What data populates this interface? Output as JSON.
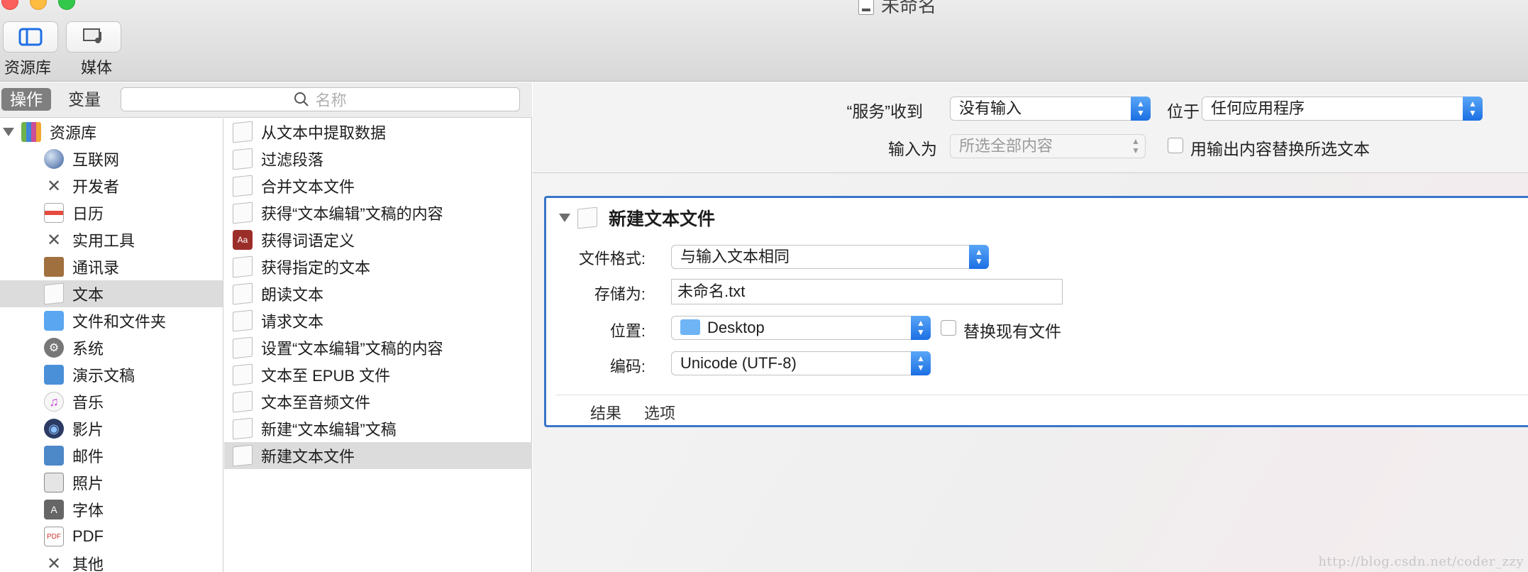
{
  "window": {
    "title": "未命名"
  },
  "toolbar": {
    "library_label": "资源库",
    "media_label": "媒体"
  },
  "left_pane": {
    "segment_actions": "操作",
    "segment_variables": "变量",
    "search_placeholder": "名称",
    "tree": {
      "root": "资源库",
      "items": [
        {
          "label": "互联网",
          "icon": "globe-icon"
        },
        {
          "label": "开发者",
          "icon": "tools-icon"
        },
        {
          "label": "日历",
          "icon": "calendar-icon"
        },
        {
          "label": "实用工具",
          "icon": "tools-icon"
        },
        {
          "label": "通讯录",
          "icon": "contacts-icon"
        },
        {
          "label": "文本",
          "icon": "text-icon",
          "selected": true
        },
        {
          "label": "文件和文件夹",
          "icon": "finder-icon"
        },
        {
          "label": "系统",
          "icon": "system-icon"
        },
        {
          "label": "演示文稿",
          "icon": "presentation-icon"
        },
        {
          "label": "音乐",
          "icon": "music-icon"
        },
        {
          "label": "影片",
          "icon": "movie-icon"
        },
        {
          "label": "邮件",
          "icon": "mail-icon"
        },
        {
          "label": "照片",
          "icon": "photo-icon"
        },
        {
          "label": "字体",
          "icon": "font-icon"
        },
        {
          "label": "PDF",
          "icon": "pdf-icon"
        },
        {
          "label": "其他",
          "icon": "tools-icon"
        }
      ]
    },
    "actions": [
      {
        "label": "从文本中提取数据",
        "icon": "text-icon"
      },
      {
        "label": "过滤段落",
        "icon": "text-icon"
      },
      {
        "label": "合并文本文件",
        "icon": "text-icon"
      },
      {
        "label": "获得“文本编辑”文稿的内容",
        "icon": "text-icon"
      },
      {
        "label": "获得词语定义",
        "icon": "dictionary-icon"
      },
      {
        "label": "获得指定的文本",
        "icon": "text-icon"
      },
      {
        "label": "朗读文本",
        "icon": "text-icon"
      },
      {
        "label": "请求文本",
        "icon": "text-icon"
      },
      {
        "label": "设置“文本编辑”文稿的内容",
        "icon": "text-icon"
      },
      {
        "label": "文本至 EPUB 文件",
        "icon": "text-icon"
      },
      {
        "label": "文本至音频文件",
        "icon": "text-icon"
      },
      {
        "label": "新建“文本编辑”文稿",
        "icon": "text-icon"
      },
      {
        "label": "新建文本文件",
        "icon": "text-icon",
        "selected": true
      }
    ]
  },
  "service_header": {
    "receives_label": "“服务”收到",
    "receives_value": "没有输入",
    "in_label": "位于",
    "in_value": "任何应用程序",
    "input_is_label": "输入为",
    "input_is_value": "所选全部内容",
    "replace_label": "用输出内容替换所选文本"
  },
  "action_card": {
    "title": "新建文本文件",
    "format_label": "文件格式:",
    "format_value": "与输入文本相同",
    "save_as_label": "存储为:",
    "save_as_value": "未命名.txt",
    "where_label": "位置:",
    "where_value": "Desktop",
    "replace_existing_label": "替换现有文件",
    "encoding_label": "编码:",
    "encoding_value": "Unicode (UTF-8)",
    "tab_results": "结果",
    "tab_options": "选项"
  },
  "watermark": "http://blog.csdn.net/coder_zzy",
  "colors": {
    "accent": "#3876c9",
    "selection": "#dcdcdc"
  }
}
